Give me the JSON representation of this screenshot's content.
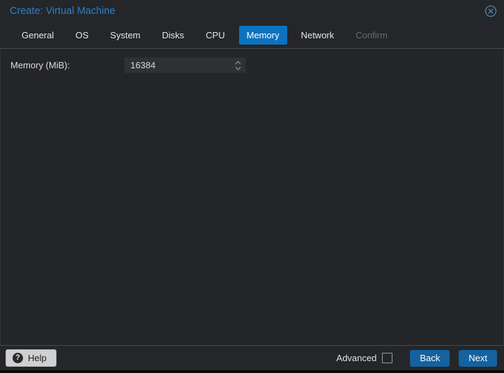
{
  "window": {
    "title": "Create: Virtual Machine",
    "close_icon": "circled-x"
  },
  "tabs": [
    {
      "label": "General",
      "state": "normal"
    },
    {
      "label": "OS",
      "state": "normal"
    },
    {
      "label": "System",
      "state": "normal"
    },
    {
      "label": "Disks",
      "state": "normal"
    },
    {
      "label": "CPU",
      "state": "normal"
    },
    {
      "label": "Memory",
      "state": "active"
    },
    {
      "label": "Network",
      "state": "normal"
    },
    {
      "label": "Confirm",
      "state": "disabled"
    }
  ],
  "form": {
    "memory_field": {
      "label": "Memory (MiB):",
      "value": "16384",
      "control": "number-spinner"
    }
  },
  "footer": {
    "help_label": "Help",
    "help_icon_glyph": "?",
    "advanced_label": "Advanced",
    "advanced_checked": false,
    "back_label": "Back",
    "next_label": "Next"
  },
  "colors": {
    "title_blue": "#2a80d0",
    "active_tab_blue": "#0d72c0",
    "button_blue": "#14629f",
    "panel_background": "#242528",
    "input_background": "#2e3135"
  }
}
